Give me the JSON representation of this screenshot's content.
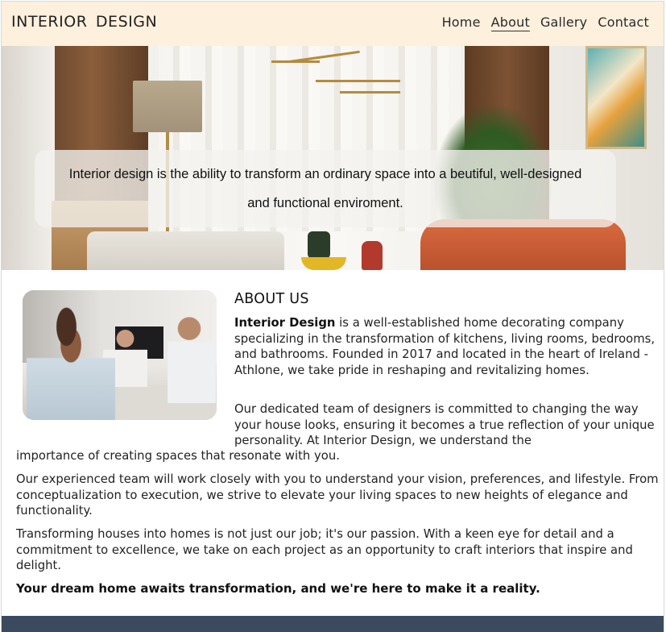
{
  "header": {
    "brand": "INTERIOR  DESIGN",
    "nav": [
      {
        "label": "Home"
      },
      {
        "label": "About"
      },
      {
        "label": "Gallery"
      },
      {
        "label": "Contact"
      }
    ],
    "active_nav": "About",
    "background": "#fdf0dd"
  },
  "hero": {
    "tagline": "Interior design is the ability to transform an ordinary space into a beutiful, well-designed and functional enviroment."
  },
  "about": {
    "title": "ABOUT US",
    "p1_strong": "Interior Design",
    "p1_rest": " is a well-established home decorating company specializing in the transformation of kitchens, living rooms, bedrooms, and bathrooms. Founded in 2017 and located in the heart of Ireland - Athlone, we take pride in reshaping and revitalizing homes.",
    "p2a": "Our dedicated team of designers is committed to changing the way your house looks, ensuring it becomes a true reflection of your unique personality. At Interior Design, we understand the",
    "p2b": "importance of creating spaces that resonate with you.",
    "p3": "Our experienced team will work closely with you to understand your vision, preferences, and lifestyle. From conceptualization to execution, we strive to elevate your living spaces to new heights of elegance and functionality.",
    "p4": "Transforming houses into homes is not just our job; it's our passion. With a keen eye for detail and a commitment to excellence, we take on each project as an opportunity to craft interiors that inspire and delight.",
    "p5": "Your dream home awaits transformation, and we're here to make it a reality."
  },
  "colors": {
    "header_bg": "#fdf0dd",
    "footer_bg": "#3b4a5e"
  }
}
